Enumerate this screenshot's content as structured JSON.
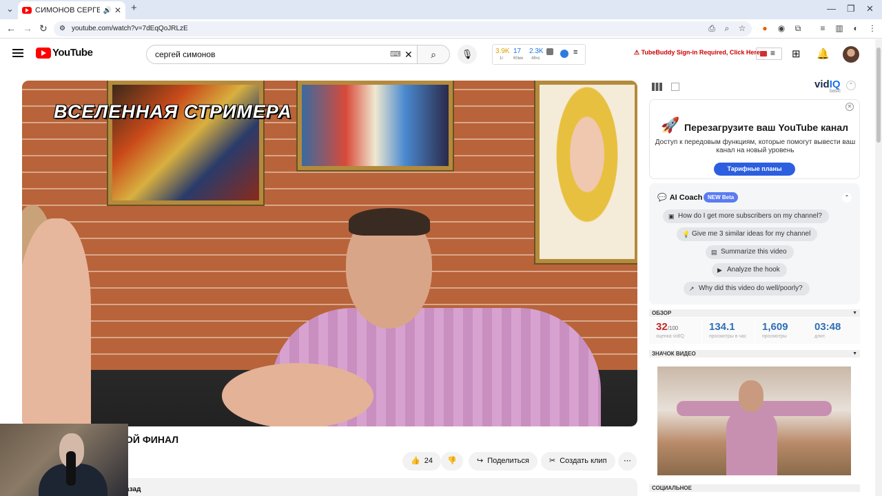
{
  "browser": {
    "tab_title": "СИМОНОВ СЕРГЕЙ - МОЙ",
    "url": "youtube.com/watch?v=7dEqQoJRLzE"
  },
  "youtube": {
    "logo_text": "YouTube",
    "search_value": "сергей симонов",
    "stats_widget": {
      "v1": "3.9K",
      "s1": "1г",
      "v2": "17",
      "s2": "60мн",
      "v3": "2.3K",
      "s3": "48чс"
    },
    "tubebuddy": "TubeBuddy Sign-in Required, Click Here"
  },
  "video": {
    "overlay_title": "ВСЕЛЕННАЯ СТРИМЕРА",
    "title": "ОЙ ФИНАЛ",
    "like_count": "24",
    "share_label": "Поделиться",
    "clip_label": "Создать клип",
    "desc_snippet": "азад"
  },
  "vidiq": {
    "logo_vid": "vid",
    "logo_iq": "IQ",
    "plan": "basic",
    "promo": {
      "title": "Перезагрузите ваш YouTube канал",
      "desc": "Доступ к передовым функциям, которые помогут вывести ваш канал на новый уровень",
      "button": "Тарифные планы"
    },
    "coach": {
      "title": "AI Coach",
      "badge": "NEW Beta",
      "q1": "How do I get more subscribers on my channel?",
      "q2": "Give me 3 similar ideas for my channel",
      "q3": "Summarize this video",
      "q4": "Analyze the hook",
      "q5": "Why did this video do well/poorly?"
    },
    "overview_label": "ОБЗОР",
    "stats": {
      "score": "32",
      "score_of": "/100",
      "score_lbl": "оценка vidIQ",
      "vph": "134.1",
      "vph_lbl": "просмотры в час",
      "views": "1,609",
      "views_lbl": "просмотры",
      "length": "03:48",
      "length_lbl": "длит."
    },
    "thumb_label": "ЗНАЧОК ВИДЕО",
    "social_label": "СОЦИАЛЬНОЕ"
  }
}
